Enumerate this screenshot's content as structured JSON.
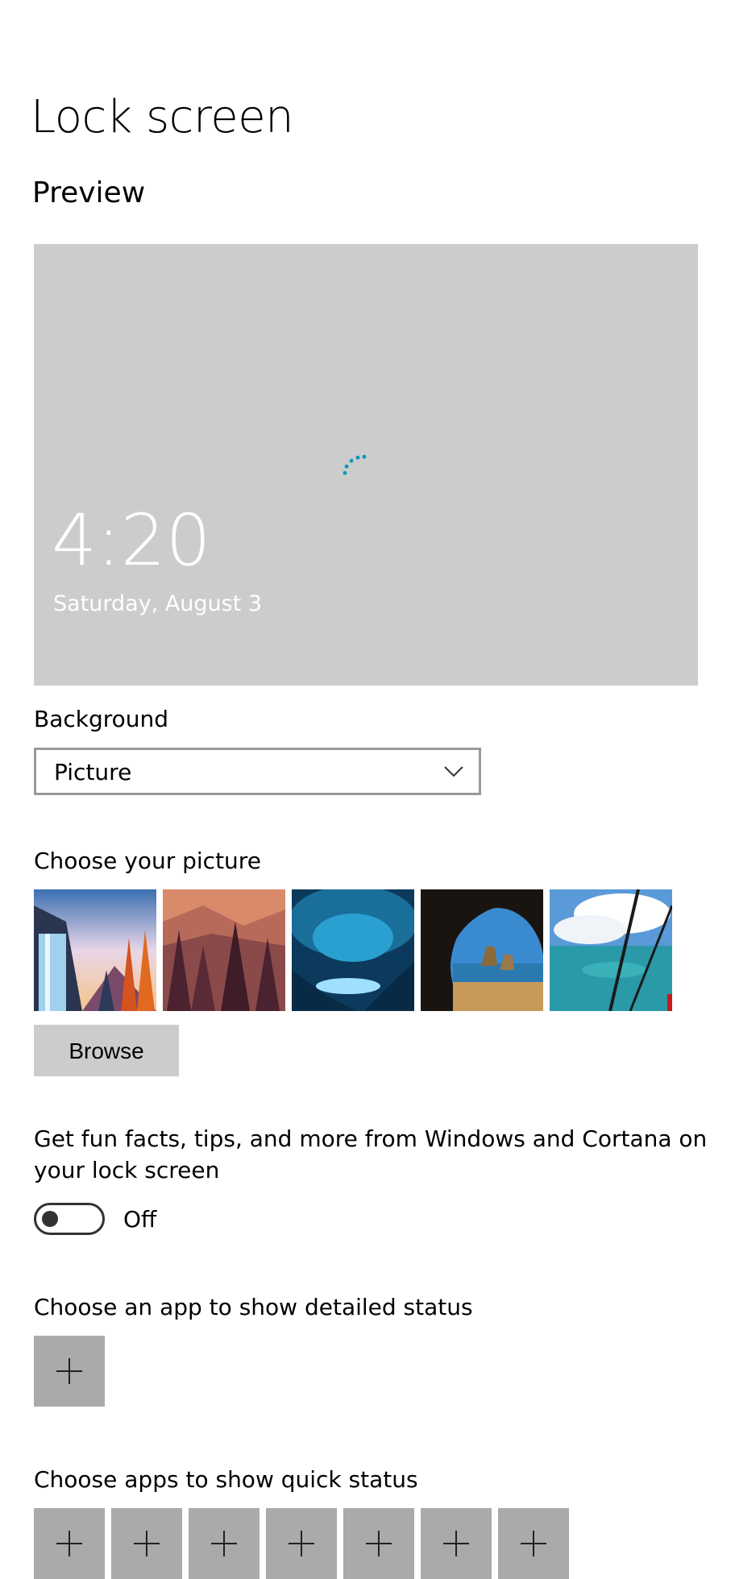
{
  "page": {
    "title": "Lock screen"
  },
  "preview": {
    "heading": "Preview",
    "time": "4:20",
    "date": "Saturday, August 3"
  },
  "background": {
    "label": "Background",
    "selected": "Picture"
  },
  "choose_picture": {
    "label": "Choose your picture",
    "thumbnails": [
      {
        "icon": "waterfall-forest-illustration"
      },
      {
        "icon": "pine-forest-illustration"
      },
      {
        "icon": "ice-cave-photo"
      },
      {
        "icon": "sea-cave-beach-photo"
      },
      {
        "icon": "airplane-window-ocean-photo"
      }
    ],
    "browse_label": "Browse"
  },
  "tips": {
    "label": "Get fun facts, tips, and more from Windows and Cortana on your lock screen",
    "state_label": "Off"
  },
  "detailed_status": {
    "label": "Choose an app to show detailed status"
  },
  "quick_status": {
    "label": "Choose apps to show quick status",
    "slot_count": 7
  },
  "colors": {
    "accent": "#0099bc",
    "preview_bg": "#cccccc",
    "button_bg": "#cccccc",
    "plus_tile_bg": "#aaaaaa"
  }
}
